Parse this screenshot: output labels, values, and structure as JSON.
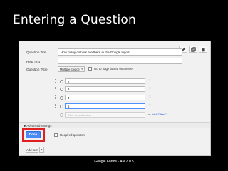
{
  "slide": {
    "title": "Entering a Question",
    "footer": "Google Forms - AN 2015"
  },
  "form": {
    "question_title_label": "Question Title",
    "question_title_value": "How many colours are there in the Google logo?",
    "help_text_label": "Help Text",
    "help_text_value": "",
    "question_type_label": "Question Type",
    "question_type_value": "Multiple choice",
    "go_to_page_label": "Go to page based on answer",
    "go_to_page_checked": false,
    "options": [
      {
        "value": "2",
        "focused": false
      },
      {
        "value": "3",
        "focused": false
      },
      {
        "value": "4",
        "focused": false
      },
      {
        "value": "5",
        "focused": true
      }
    ],
    "add_option_placeholder": "Click to add option",
    "add_option_or": "or",
    "add_other_label": "Add \"Other\"",
    "advanced_settings_label": "▶ Advanced settings",
    "done_label": "Done",
    "required_label": "Required question",
    "required_checked": false,
    "add_item_label": "Add item",
    "add_item_caret": "▾",
    "remove_glyph": "×",
    "type_caret": "▾"
  },
  "toolbar": {
    "icons": [
      "pencil-icon",
      "copy-icon",
      "trash-icon"
    ]
  },
  "colors": {
    "done_button": "#4a8af4",
    "highlight_border": "#e02020",
    "link": "#1155cc"
  }
}
